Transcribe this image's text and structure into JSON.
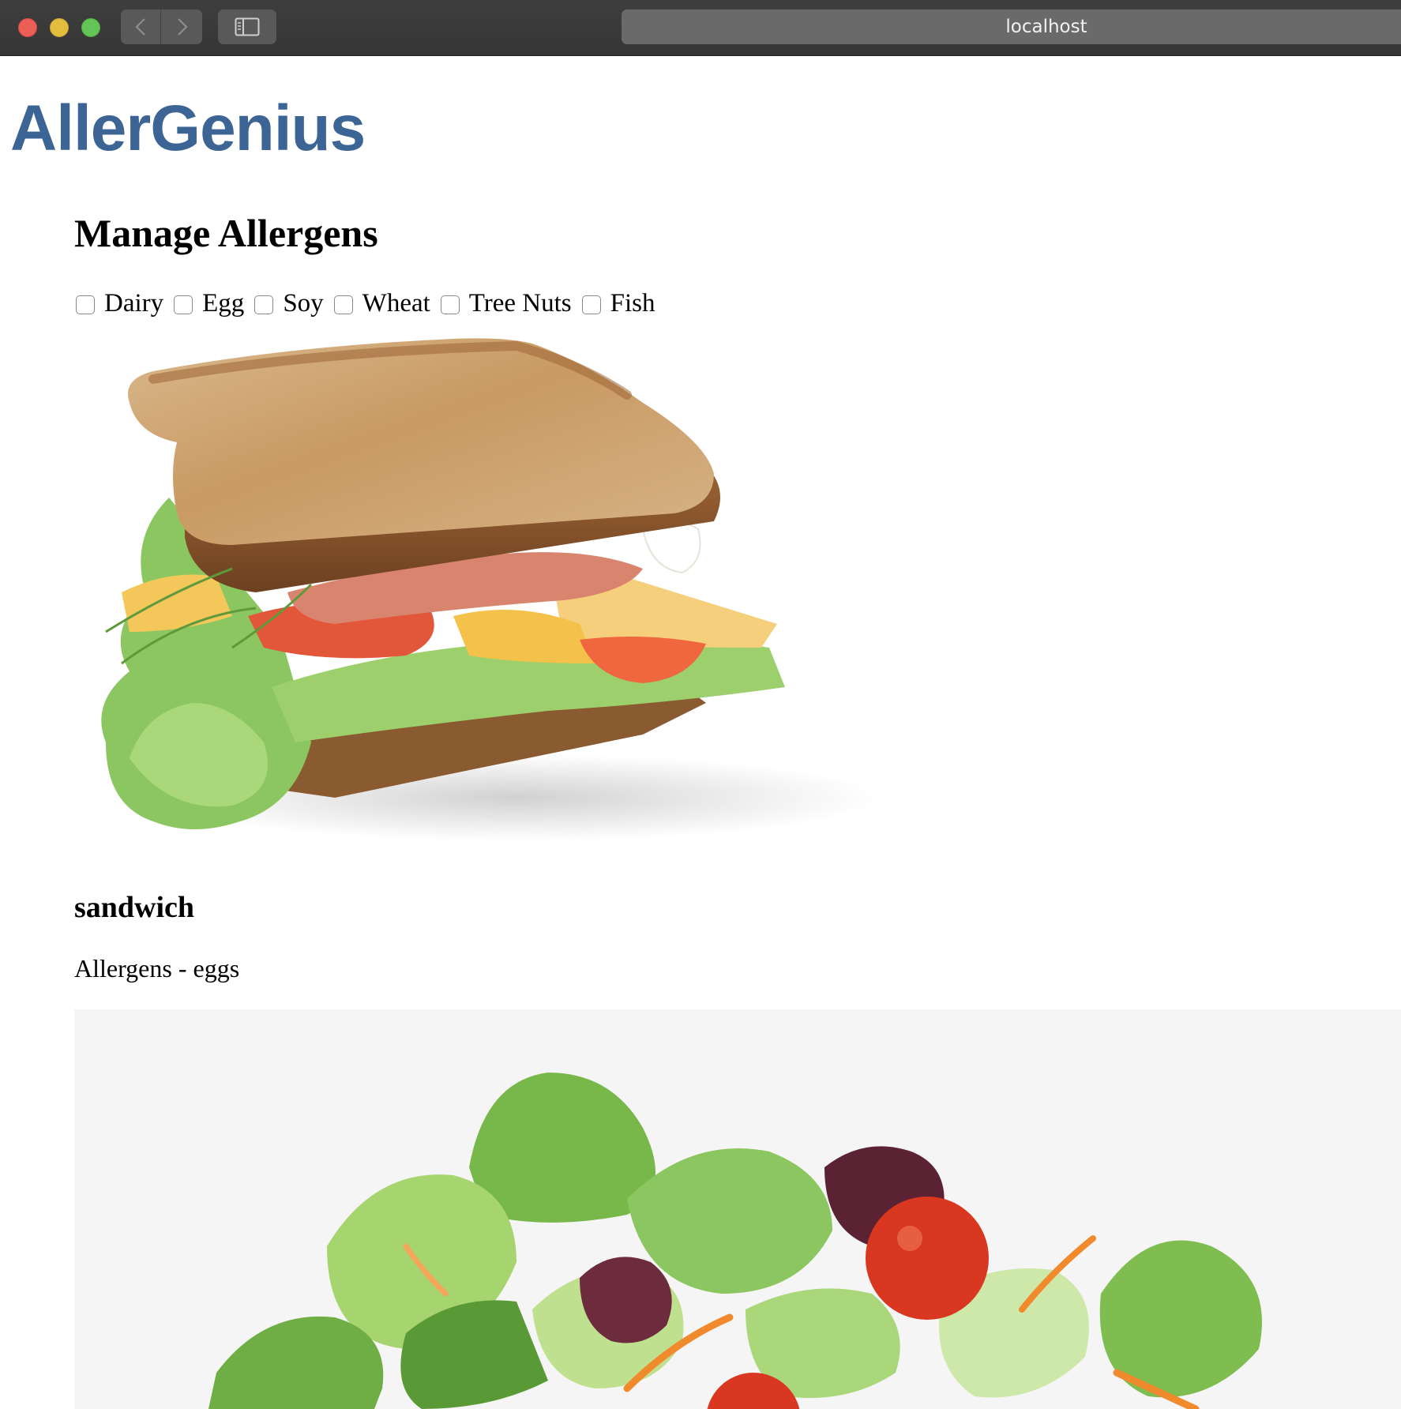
{
  "browser": {
    "url": "localhost"
  },
  "app": {
    "brand": "AllerGenius"
  },
  "allergens": {
    "title": "Manage Allergens",
    "options": [
      {
        "label": "Dairy",
        "checked": false
      },
      {
        "label": "Egg",
        "checked": false
      },
      {
        "label": "Soy",
        "checked": false
      },
      {
        "label": "Wheat",
        "checked": false
      },
      {
        "label": "Tree Nuts",
        "checked": false
      },
      {
        "label": "Fish",
        "checked": false
      }
    ]
  },
  "foods": [
    {
      "name": "sandwich",
      "allergens_text": "Allergens - eggs",
      "image": "sandwich-photo"
    },
    {
      "image": "salad-photo"
    }
  ],
  "colors": {
    "brand": "#3c6596",
    "titlebar": "#3a3939"
  }
}
